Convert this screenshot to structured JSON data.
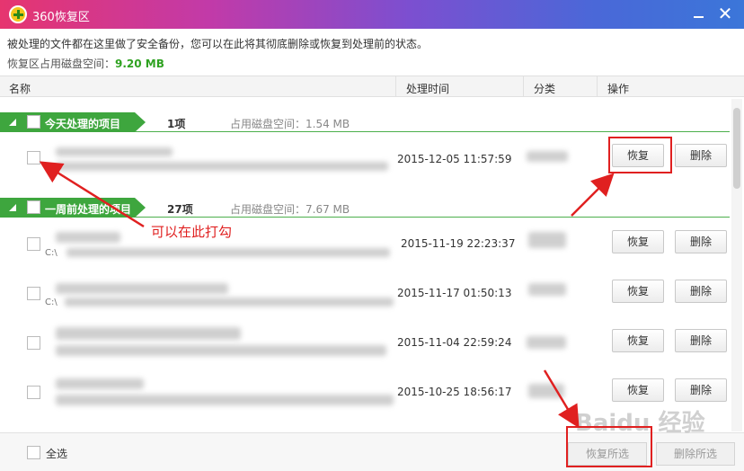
{
  "window": {
    "title": "360恢复区"
  },
  "info": {
    "description": "被处理的文件都在这里做了安全备份，您可以在此将其彻底删除或恢复到处理前的状态。",
    "disk_label": "恢复区占用磁盘空间：",
    "disk_value": "9.20 MB"
  },
  "columns": {
    "name": "名称",
    "time": "处理时间",
    "category": "分类",
    "action": "操作"
  },
  "groups": [
    {
      "label": "今天处理的项目",
      "count": "1项",
      "size": "占用磁盘空间：1.54 MB"
    },
    {
      "label": "一周前处理的项目",
      "count": "27项",
      "size": "占用磁盘空间：7.67 MB"
    }
  ],
  "rows": [
    {
      "path": "",
      "time": "2015-12-05 11:57:59"
    },
    {
      "path": "C:\\",
      "time": "2015-11-19 22:23:37"
    },
    {
      "path": "C:\\",
      "time": "2015-11-17 01:50:13"
    },
    {
      "path": "",
      "time": "2015-11-04 22:59:24"
    },
    {
      "path": "",
      "time": "2015-10-25 18:56:17"
    }
  ],
  "buttons": {
    "restore": "恢复",
    "delete": "删除"
  },
  "footer": {
    "select_all": "全选",
    "restore_selected": "恢复所选",
    "delete_selected": "删除所选"
  },
  "annotation": "可以在此打勾",
  "watermark": "Baidu 经验",
  "colors": {
    "accent_green": "#3ea63e",
    "annotation_red": "#e02020"
  }
}
